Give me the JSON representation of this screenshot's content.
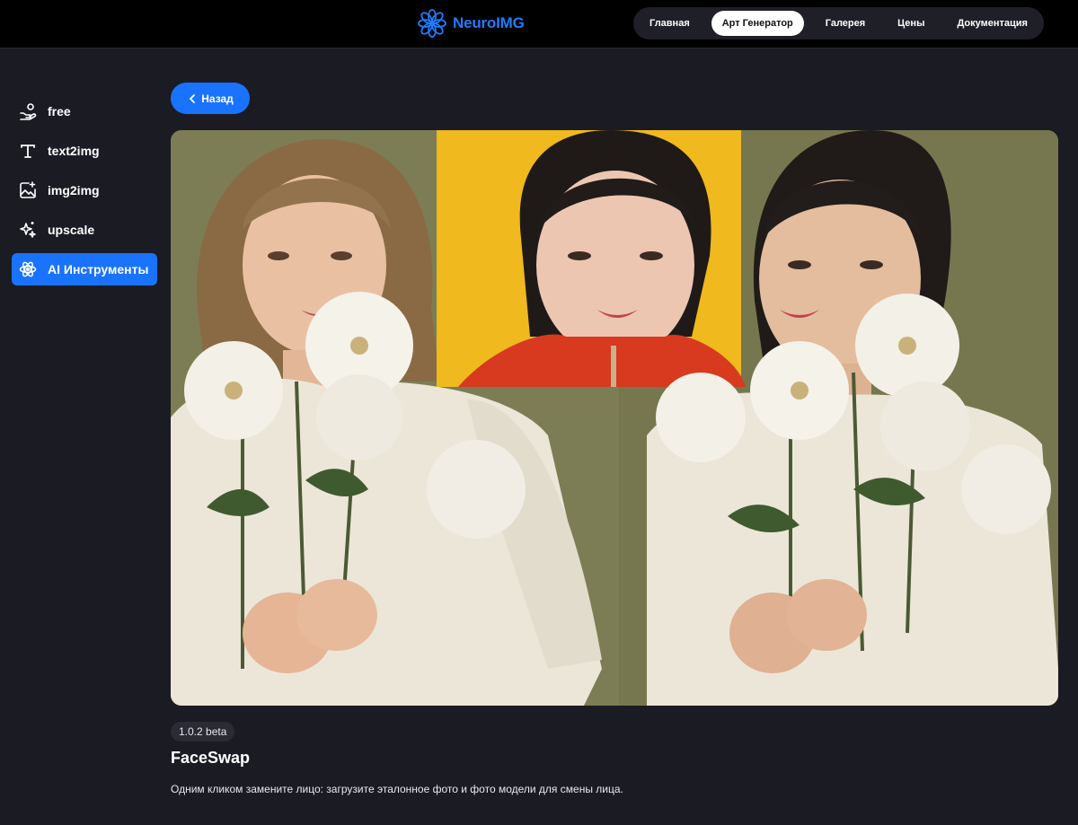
{
  "brand": {
    "name": "NeuroIMG",
    "accent_color": "#1f7bff",
    "logo_icon": "flower-logo-icon"
  },
  "nav": {
    "items": [
      {
        "label": "Главная",
        "active": false
      },
      {
        "label": "Арт Генератор",
        "active": true
      },
      {
        "label": "Галерея",
        "active": false
      },
      {
        "label": "Цены",
        "active": false
      },
      {
        "label": "Документация",
        "active": false
      }
    ]
  },
  "sidebar": {
    "items": [
      {
        "label": "free",
        "icon": "hand-coins-icon",
        "active": false
      },
      {
        "label": "text2img",
        "icon": "text-t-icon",
        "active": false
      },
      {
        "label": "img2img",
        "icon": "image-sparkle-icon",
        "active": false
      },
      {
        "label": "upscale",
        "icon": "sparkles-icon",
        "active": false
      },
      {
        "label": "AI Инструменты",
        "icon": "atom-icon",
        "active": true
      }
    ],
    "active_color": "#1a73ff"
  },
  "back_button": {
    "label": "Назад",
    "icon": "chevron-left-icon"
  },
  "hero": {
    "description": "FaceSwap example: source portrait, reference face, result portrait"
  },
  "tool": {
    "version": "1.0.2 beta",
    "title": "FaceSwap",
    "description": "Одним кликом замените лицо: загрузите эталонное фото и фото модели для смены лица."
  }
}
